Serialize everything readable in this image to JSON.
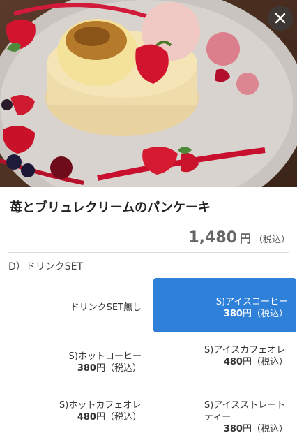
{
  "product": {
    "title": "苺とブリュレクリームのパンケーキ",
    "price": "1,480",
    "yen": "円",
    "tax": "（税込）"
  },
  "section": {
    "label": "D）ドリンクSET"
  },
  "options": [
    {
      "name": "ドリンクSET無し",
      "price": "",
      "yen": "",
      "tax": "",
      "selected": false
    },
    {
      "name": "S)アイスコーヒー",
      "price": "380",
      "yen": "円",
      "tax": "（税込）",
      "selected": true
    },
    {
      "name": "S)ホットコーヒー",
      "price": "380",
      "yen": "円",
      "tax": "（税込）",
      "selected": false
    },
    {
      "name": "S)アイスカフェオレ",
      "price": "480",
      "yen": "円",
      "tax": "（税込）",
      "selected": false
    },
    {
      "name": "S)ホットカフェオレ",
      "price": "480",
      "yen": "円",
      "tax": "（税込）",
      "selected": false
    },
    {
      "name": "S)アイスストレートティー",
      "price": "380",
      "yen": "円",
      "tax": "（税込）",
      "selected": false
    }
  ],
  "icons": {
    "close": "close-icon"
  },
  "colors": {
    "accent": "#2f80d9"
  }
}
